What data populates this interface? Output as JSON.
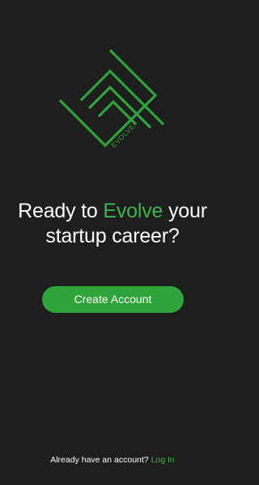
{
  "logo": {
    "text": "EVOLVE",
    "color": "#2ea43a"
  },
  "headline": {
    "prefix": "Ready to ",
    "accent": "Evolve",
    "suffix": " your startup career?"
  },
  "actions": {
    "create_account_label": "Create Account"
  },
  "footer": {
    "prompt": "Already have an account? ",
    "login_label": "Log In"
  },
  "colors": {
    "background": "#1e1e1e",
    "accent": "#3cb54a",
    "button": "#2ea43a",
    "text": "#ffffff"
  }
}
